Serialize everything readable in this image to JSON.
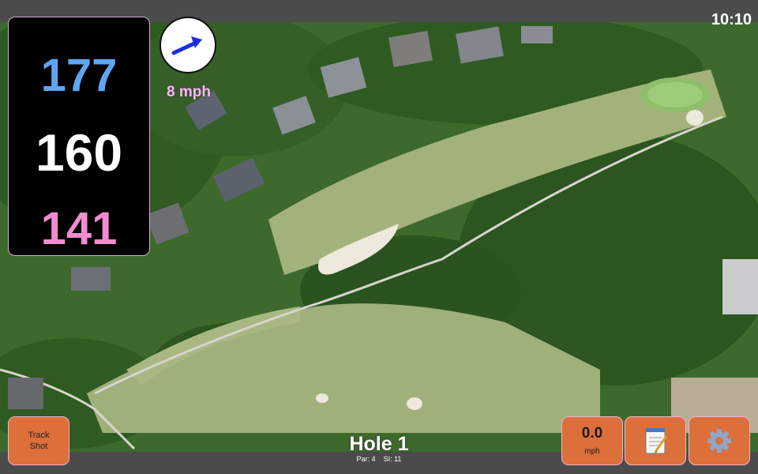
{
  "status": {
    "clock": "10:10"
  },
  "distances": {
    "back": "177",
    "middle": "160",
    "front": "141"
  },
  "wind": {
    "speed": "8 mph",
    "icon": "wind-arrow-icon"
  },
  "hole": {
    "title": "Hole 1",
    "par_label": "Par: 4",
    "si_label": "SI: 11"
  },
  "buttons": {
    "track_shot_line1": "Track",
    "track_shot_line2": "Shot",
    "speed_value": "0.0",
    "speed_unit": "mph",
    "notes_icon": "notepad-icon",
    "settings_icon": "gear-icon"
  },
  "colors": {
    "back": "#5ea6f3",
    "middle": "#ffffff",
    "front": "#f28bd0",
    "button": "#dc6f3a",
    "wind_text": "#f4b9f2"
  }
}
